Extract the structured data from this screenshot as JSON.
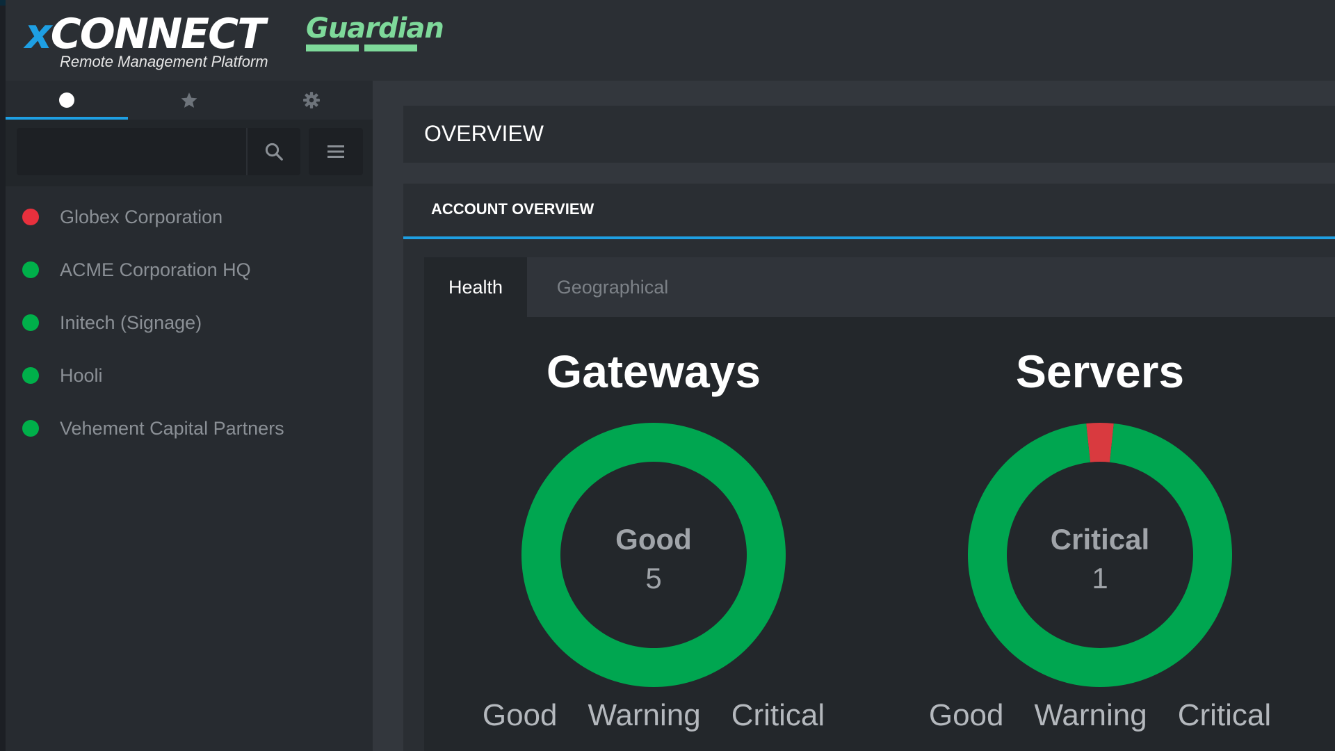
{
  "logo": {
    "brand_prefix": "x",
    "brand_main": "CONNECT",
    "product": "Guardian",
    "tagline": "Remote Management Platform"
  },
  "sidebar": {
    "tabs": [
      {
        "icon": "circle-icon",
        "active": true
      },
      {
        "icon": "star-icon",
        "active": false
      },
      {
        "icon": "gear-icon",
        "active": false
      }
    ],
    "search": {
      "value": "",
      "placeholder": ""
    },
    "accounts": [
      {
        "name": "Globex Corporation",
        "status": "critical",
        "color": "#e8303d"
      },
      {
        "name": "ACME Corporation HQ",
        "status": "good",
        "color": "#00b04a"
      },
      {
        "name": "Initech (Signage)",
        "status": "good",
        "color": "#00b04a"
      },
      {
        "name": "Hooli",
        "status": "good",
        "color": "#00b04a"
      },
      {
        "name": "Vehement Capital Partners",
        "status": "good",
        "color": "#00b04a"
      }
    ]
  },
  "main": {
    "title": "OVERVIEW",
    "panel_title": "ACCOUNT OVERVIEW",
    "tabs": [
      {
        "label": "Health",
        "active": true
      },
      {
        "label": "Geographical",
        "active": false
      }
    ]
  },
  "chart_data": [
    {
      "type": "pie",
      "title": "Gateways",
      "center_label": "Good",
      "center_value": "5",
      "categories": [
        "Good",
        "Warning",
        "Critical"
      ],
      "values": [
        5,
        0,
        0
      ],
      "colors": [
        "#00a650",
        "#f0a020",
        "#d93a3f"
      ]
    },
    {
      "type": "pie",
      "title": "Servers",
      "center_label": "Critical",
      "center_value": "1",
      "categories": [
        "Good",
        "Warning",
        "Critical"
      ],
      "values": [
        29,
        0,
        1
      ],
      "colors": [
        "#00a650",
        "#f0a020",
        "#d93a3f"
      ]
    }
  ]
}
